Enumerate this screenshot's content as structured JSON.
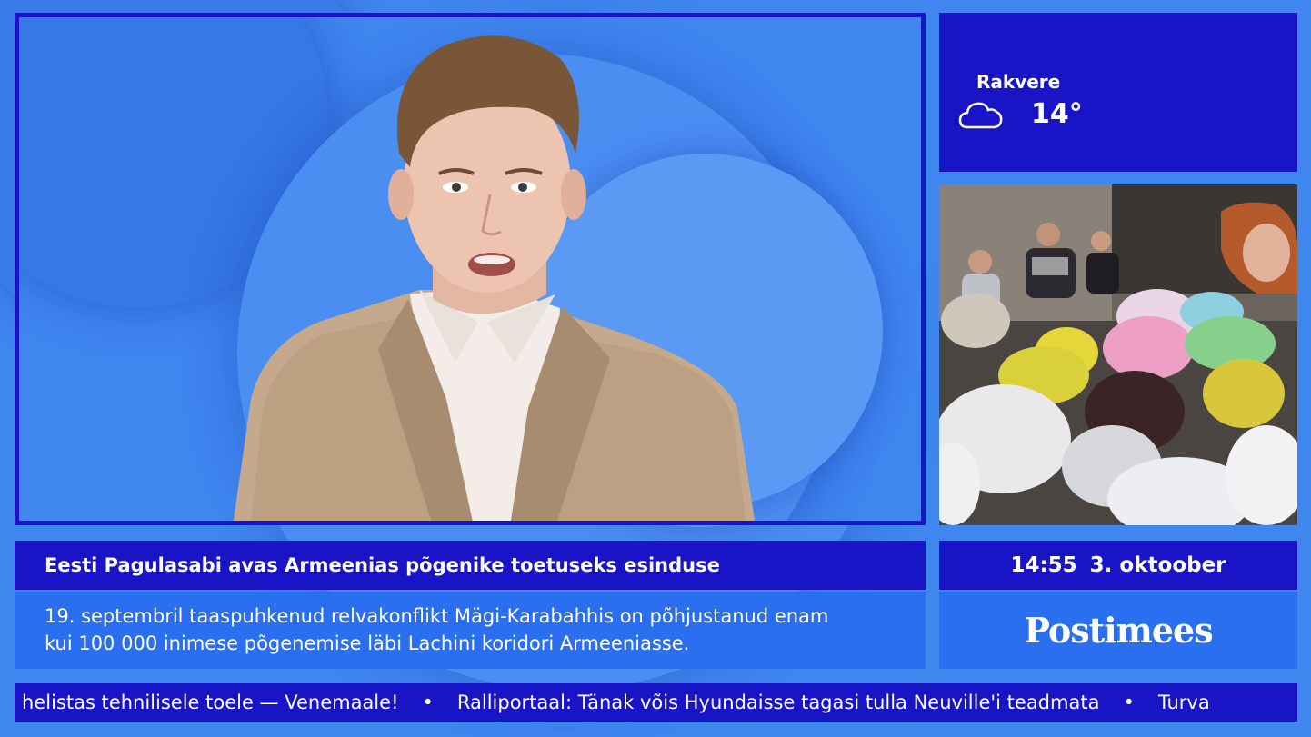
{
  "weather": {
    "city": "Rakvere",
    "temperature": "14°",
    "icon": "cloud-icon"
  },
  "headline": "Eesti Pagulasabi avas Armeenias põgenike toetuseks esinduse",
  "summary_lines": [
    "19. septembril taaspuhkenud relvakonflikt Mägi-Karabahhis on põhjustanud enam",
    "kui 100 000 inimese põgenemise läbi Lachini koridori Armeeniasse."
  ],
  "clock": {
    "time": "14:55",
    "date": "3. oktoober"
  },
  "brand": "Postimees",
  "ticker": {
    "items": [
      "helistas tehnilisele toele — Venemaale!",
      "Ralliportaal: Tänak võis Hyundaisse tagasi tulla Neuville'i teadmata",
      "Turva"
    ],
    "separator": "•"
  },
  "colors": {
    "panel_dark": "#1a14c7",
    "panel_light": "#2a6ff0",
    "background": "#3f86ef"
  }
}
